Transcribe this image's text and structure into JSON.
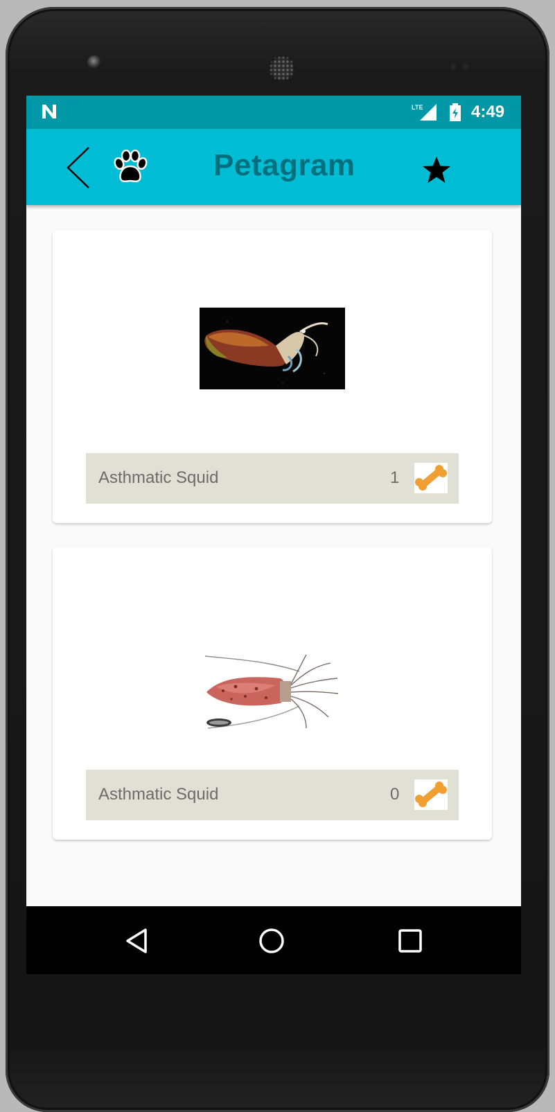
{
  "status_bar": {
    "time": "4:49",
    "network_label": "LTE",
    "icons": [
      "notification-n-icon",
      "signal-icon",
      "battery-icon"
    ]
  },
  "app_bar": {
    "title": "Petagram",
    "icons": [
      "back-arrow-icon",
      "paw-icon",
      "star-icon"
    ]
  },
  "pets": [
    {
      "name": "Asthmatic Squid",
      "likes": "1",
      "photo": "squid-dark-photo"
    },
    {
      "name": "Asthmatic Squid",
      "likes": "0",
      "photo": "squid-light-photo"
    }
  ],
  "nav_bar": {
    "icons": [
      "nav-back-icon",
      "nav-home-icon",
      "nav-recents-icon"
    ]
  },
  "colors": {
    "status_bar": "#0097a7",
    "app_bar": "#00bcd4",
    "title": "#00707f",
    "card_bar": "#e1e0d5",
    "bone": "#f0a033"
  }
}
